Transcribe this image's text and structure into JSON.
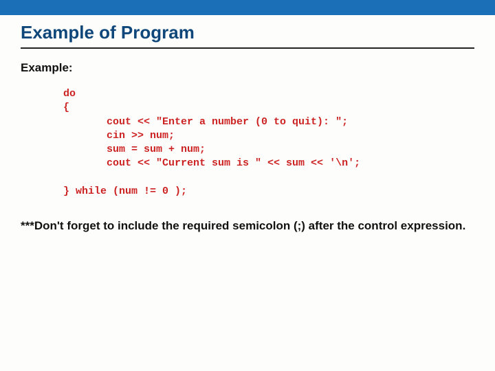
{
  "title": "Example of Program",
  "example_label": "Example:",
  "code": "do\n{\n       cout << \"Enter a number (0 to quit): \";\n       cin >> num;\n       sum = sum + num;\n       cout << \"Current sum is \" << sum << '\\n';\n\n} while (num != 0 );",
  "note": "***Don't forget to include the required semicolon (;) after the control expression."
}
